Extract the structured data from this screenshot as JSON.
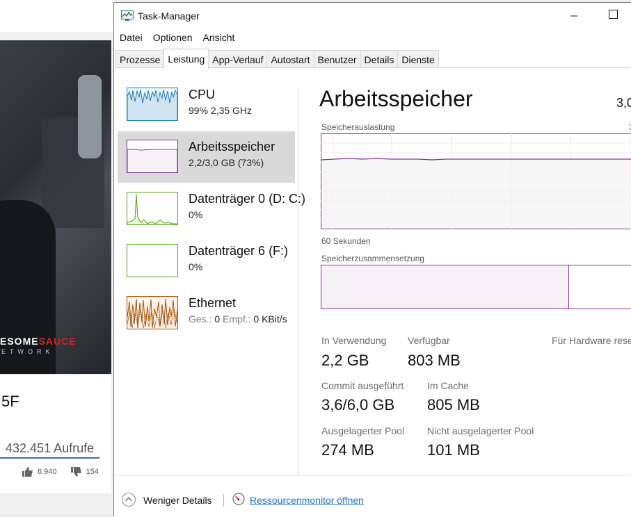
{
  "background": {
    "logo": {
      "prefix": "ESOME",
      "suffix": "SAUCE"
    },
    "logo_sub": "ETWORK",
    "video_title": "5F",
    "views": "432.451 Aufrufe",
    "likes": "6.940",
    "dislikes": "154"
  },
  "window": {
    "title": "Task-Manager"
  },
  "menu": [
    "Datei",
    "Optionen",
    "Ansicht"
  ],
  "tabs": [
    {
      "label": "Prozesse",
      "active": false
    },
    {
      "label": "Leistung",
      "active": true
    },
    {
      "label": "App-Verlauf",
      "active": false
    },
    {
      "label": "Autostart",
      "active": false
    },
    {
      "label": "Benutzer",
      "active": false
    },
    {
      "label": "Details",
      "active": false
    },
    {
      "label": "Dienste",
      "active": false
    }
  ],
  "sidebar": [
    {
      "name": "CPU",
      "sub": "99%  2,35 GHz",
      "color": "#117dbb",
      "selected": false
    },
    {
      "name": "Arbeitsspeicher",
      "sub": "2,2/3,0 GB (73%)",
      "color": "#8b2d9b",
      "selected": true
    },
    {
      "name": "Datenträger 0 (D: C:)",
      "sub": "0%",
      "color": "#4da60c",
      "selected": false
    },
    {
      "name": "Datenträger 6 (F:)",
      "sub": "0%",
      "color": "#4da60c",
      "selected": false
    },
    {
      "name": "Ethernet",
      "sub_send_label": "Ges.:",
      "sub_send": "0",
      "sub_recv_label": "Empf.:",
      "sub_recv": "0 KBit/s",
      "color": "#a74f01",
      "selected": false
    }
  ],
  "main": {
    "title": "Arbeitsspeicher",
    "total": "3,0",
    "usage_label": "Speicherauslastung",
    "usage_max": "3",
    "time_label": "60 Sekunden",
    "composition_label": "Speicherzusammensetzung",
    "stats": {
      "in_use": {
        "label": "In Verwendung",
        "value": "2,2 GB"
      },
      "available": {
        "label": "Verfügbar",
        "value": "803 MB"
      },
      "hw_reserved": {
        "label": "Für Hardware rese"
      },
      "committed": {
        "label": "Commit ausgeführt",
        "value": "3,6/6,0 GB"
      },
      "cached": {
        "label": "Im Cache",
        "value": "805 MB"
      },
      "paged_pool": {
        "label": "Ausgelagerter Pool",
        "value": "274 MB"
      },
      "nonpaged_pool": {
        "label": "Nicht ausgelagerter Pool",
        "value": "101 MB"
      }
    },
    "usage_fraction": 0.73
  },
  "footer": {
    "less_details": "Weniger Details",
    "resource_monitor": "Ressourcenmonitor öffnen"
  }
}
